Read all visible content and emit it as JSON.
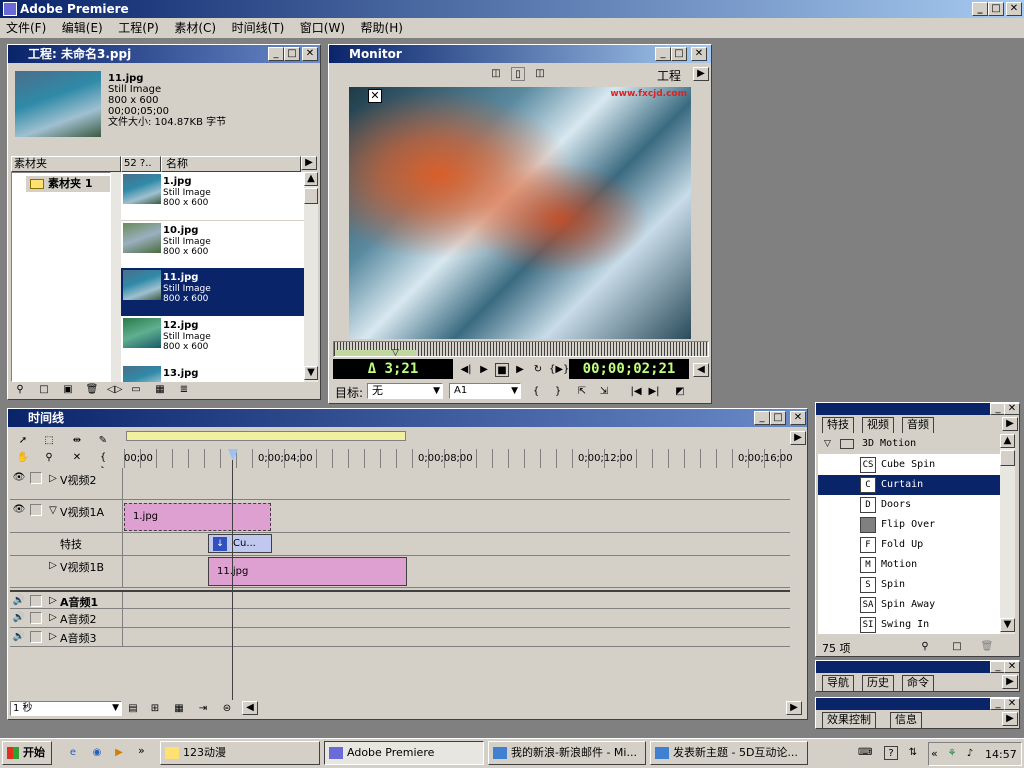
{
  "app": {
    "title": "Adobe Premiere"
  },
  "menu": [
    "文件(F)",
    "编辑(E)",
    "工程(P)",
    "素材(C)",
    "时间线(T)",
    "窗口(W)",
    "帮助(H)"
  ],
  "project": {
    "title": "工程: 未命名3.ppj",
    "preview": {
      "name": "11.jpg",
      "type": "Still Image",
      "size": "800 x 600",
      "duration": "00;00;05;00",
      "filesize": "文件大小: 104.87KB 字节"
    },
    "col_bin": "素材夹",
    "col_count": "52 ?..",
    "col_name": "名称",
    "bin_name": "素材夹 1",
    "items": [
      {
        "name": "1.jpg",
        "type": "Still Image",
        "size": "800 x 600"
      },
      {
        "name": "10.jpg",
        "type": "Still Image",
        "size": "800 x 600"
      },
      {
        "name": "11.jpg",
        "type": "Still Image",
        "size": "800 x 600"
      },
      {
        "name": "12.jpg",
        "type": "Still Image",
        "size": "800 x 600"
      },
      {
        "name": "13.jpg",
        "type": "",
        "size": ""
      }
    ]
  },
  "monitor": {
    "title": "Monitor",
    "mode": "工程",
    "watermark": "www.fxcjd.com",
    "duration": "Δ 3;21",
    "timecode": "00;00;02;21",
    "target_label": "目标:",
    "target_value": "无",
    "audio_target": "A1"
  },
  "timeline": {
    "title": "时间线",
    "ruler": [
      "00;00",
      "0;00;04;00",
      "0;00;08;00",
      "0;00;12;00",
      "0;00;16;00"
    ],
    "tracks": {
      "v2": "V视频2",
      "v1a": "V视频1A",
      "fx": "特技",
      "v1b": "V视频1B",
      "a1": "A音频1",
      "a2": "A音频2",
      "a3": "A音频3"
    },
    "clips": {
      "a": "1.jpg",
      "fx": "Cu...",
      "b": "11.jpg"
    },
    "scale": "1 秒"
  },
  "effects": {
    "tabs": [
      "特技",
      "视频",
      "音频"
    ],
    "folder": "3D Motion",
    "items": [
      {
        "icon": "CS",
        "label": "Cube Spin"
      },
      {
        "icon": "C",
        "label": "Curtain"
      },
      {
        "icon": "D",
        "label": "Doors"
      },
      {
        "icon": "",
        "label": "Flip Over"
      },
      {
        "icon": "F",
        "label": "Fold Up"
      },
      {
        "icon": "M",
        "label": "Motion"
      },
      {
        "icon": "S",
        "label": "Spin"
      },
      {
        "icon": "SA",
        "label": "Spin Away"
      },
      {
        "icon": "SI",
        "label": "Swing In"
      }
    ],
    "count": "75 项"
  },
  "nav": {
    "tabs": [
      "导航",
      "历史",
      "命令"
    ]
  },
  "fxctrl": {
    "tabs": [
      "效果控制",
      "信息"
    ]
  },
  "taskbar": {
    "start": "开始",
    "items": [
      "123动漫",
      "Adobe Premiere",
      "我的新浪-新浪邮件 - Mi...",
      "发表新主题 - 5D互动论..."
    ],
    "clock": "14:57"
  }
}
